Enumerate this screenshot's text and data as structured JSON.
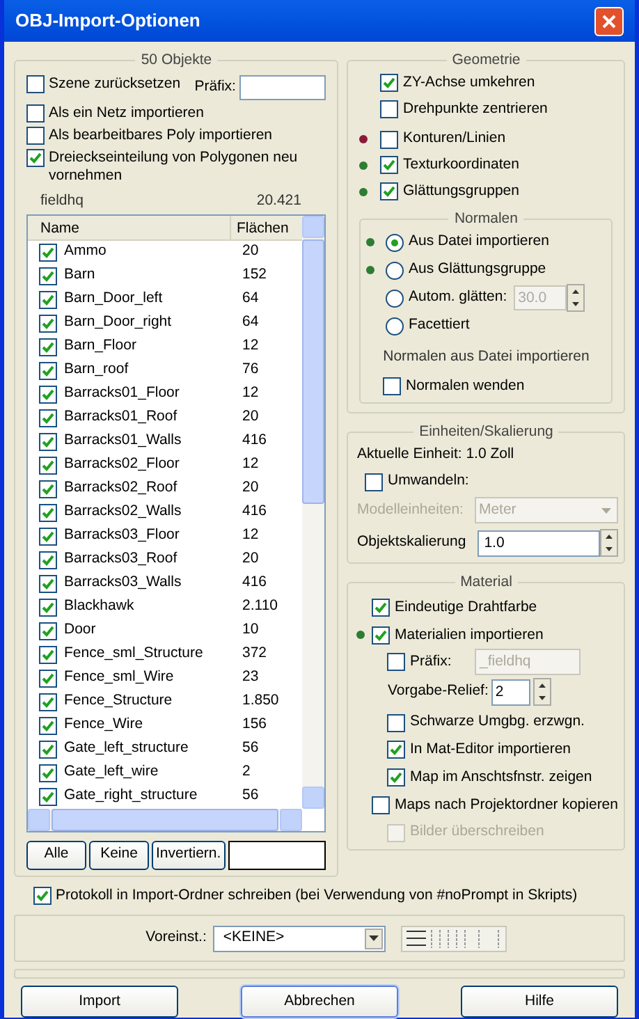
{
  "window": {
    "title": "OBJ-Import-Optionen"
  },
  "objects": {
    "title": "50 Objekte",
    "options": [
      {
        "label": "Szene zurücksetzen",
        "checked": false
      },
      {
        "label": "Als ein Netz importieren",
        "checked": false
      },
      {
        "label": "Als bearbeitbares Poly importieren",
        "checked": false
      },
      {
        "label": "Dreieckseinteilung von Polygonen neu vornehmen",
        "checked": true
      }
    ],
    "prefix_label": "Präfix:",
    "summary": {
      "name": "fieldhq",
      "faces": "20.421"
    },
    "table": {
      "columns": [
        "Name",
        "Flächen"
      ],
      "rows": [
        {
          "name": "Ammo",
          "faces": "20",
          "checked": true
        },
        {
          "name": "Barn",
          "faces": "152",
          "checked": true
        },
        {
          "name": "Barn_Door_left",
          "faces": "64",
          "checked": true
        },
        {
          "name": "Barn_Door_right",
          "faces": "64",
          "checked": true
        },
        {
          "name": "Barn_Floor",
          "faces": "12",
          "checked": true
        },
        {
          "name": "Barn_roof",
          "faces": "76",
          "checked": true
        },
        {
          "name": "Barracks01_Floor",
          "faces": "12",
          "checked": true
        },
        {
          "name": "Barracks01_Roof",
          "faces": "20",
          "checked": true
        },
        {
          "name": "Barracks01_Walls",
          "faces": "416",
          "checked": true
        },
        {
          "name": "Barracks02_Floor",
          "faces": "12",
          "checked": true
        },
        {
          "name": "Barracks02_Roof",
          "faces": "20",
          "checked": true
        },
        {
          "name": "Barracks02_Walls",
          "faces": "416",
          "checked": true
        },
        {
          "name": "Barracks03_Floor",
          "faces": "12",
          "checked": true
        },
        {
          "name": "Barracks03_Roof",
          "faces": "20",
          "checked": true
        },
        {
          "name": "Barracks03_Walls",
          "faces": "416",
          "checked": true
        },
        {
          "name": "Blackhawk",
          "faces": "2.110",
          "checked": true
        },
        {
          "name": "Door",
          "faces": "10",
          "checked": true
        },
        {
          "name": "Fence_sml_Structure",
          "faces": "372",
          "checked": true
        },
        {
          "name": "Fence_sml_Wire",
          "faces": "23",
          "checked": true
        },
        {
          "name": "Fence_Structure",
          "faces": "1.850",
          "checked": true
        },
        {
          "name": "Fence_Wire",
          "faces": "156",
          "checked": true
        },
        {
          "name": "Gate_left_structure",
          "faces": "56",
          "checked": true
        },
        {
          "name": "Gate_left_wire",
          "faces": "2",
          "checked": true
        },
        {
          "name": "Gate_right_structure",
          "faces": "56",
          "checked": true
        }
      ]
    },
    "buttons": [
      "Alle",
      "Keine",
      "Invertiern."
    ]
  },
  "geometry": {
    "title": "Geometrie",
    "options": [
      {
        "label": "ZY-Achse umkehren",
        "checked": true
      },
      {
        "label": "Drehpunkte zentrieren",
        "checked": false
      },
      {
        "label": "Konturen/Linien",
        "checked": false,
        "color": "#8b1a3a"
      },
      {
        "label": "Texturkoordinaten",
        "checked": true,
        "color": "#2e7d32"
      },
      {
        "label": "Glättungsgruppen",
        "checked": true,
        "color": "#2e7d32"
      }
    ],
    "normals": {
      "title": "Normalen",
      "options": [
        {
          "label": "Aus Datei importieren",
          "selected": true,
          "color": "#2e7d32"
        },
        {
          "label": "Aus Glättungsgruppe",
          "selected": false,
          "color": "#2e7d32"
        },
        {
          "label": "Autom. glätten:",
          "selected": false,
          "value": "30.0"
        },
        {
          "label": "Facettiert",
          "selected": false
        }
      ],
      "note": "Normalen aus Datei importieren",
      "flip": {
        "label": "Normalen wenden",
        "checked": false
      }
    }
  },
  "units": {
    "title": "Einheiten/Skalierung",
    "current": "Aktuelle Einheit: 1.0 Zoll",
    "convert": {
      "label": "Umwandeln:",
      "checked": false
    },
    "model_units": {
      "label": "Modelleinheiten:",
      "value": "Meter",
      "disabled": true
    },
    "scale": {
      "label": "Objektskalierung",
      "value": "1.0"
    }
  },
  "material": {
    "title": "Material",
    "items": [
      {
        "kind": "checkbox",
        "label": "Eindeutige Drahtfarbe",
        "checked": true
      },
      {
        "kind": "checkbox",
        "label": "Materialien importieren",
        "checked": true,
        "color": "#2e7d32"
      },
      {
        "kind": "prefix",
        "label": "Präfix:",
        "checked": false,
        "value": "_fieldhq"
      },
      {
        "kind": "spinner",
        "label": "Vorgabe-Relief:",
        "value": "2"
      },
      {
        "kind": "checkbox",
        "label": "Schwarze Umgbg. erzwgn.",
        "checked": false,
        "indent": true
      },
      {
        "kind": "checkbox",
        "label": "In Mat-Editor importieren",
        "checked": true,
        "indent": true
      },
      {
        "kind": "checkbox",
        "label": "Map im Anschtsfnstr. zeigen",
        "checked": true,
        "indent": true
      },
      {
        "kind": "checkbox",
        "label": "Maps nach Projektordner kopieren",
        "checked": false
      },
      {
        "kind": "checkbox",
        "label": "Bilder überschreiben",
        "checked": false,
        "indent": true,
        "disabled": true
      }
    ]
  },
  "log": {
    "label": "Protokoll in Import-Ordner schreiben (bei Verwendung von #noPrompt in Skripts)",
    "checked": true
  },
  "preset": {
    "label": "Voreinst.:",
    "value": "<KEINE>"
  },
  "progress": {
    "level": 0
  },
  "actions": [
    "Import",
    "Abbrechen",
    "Hilfe"
  ]
}
